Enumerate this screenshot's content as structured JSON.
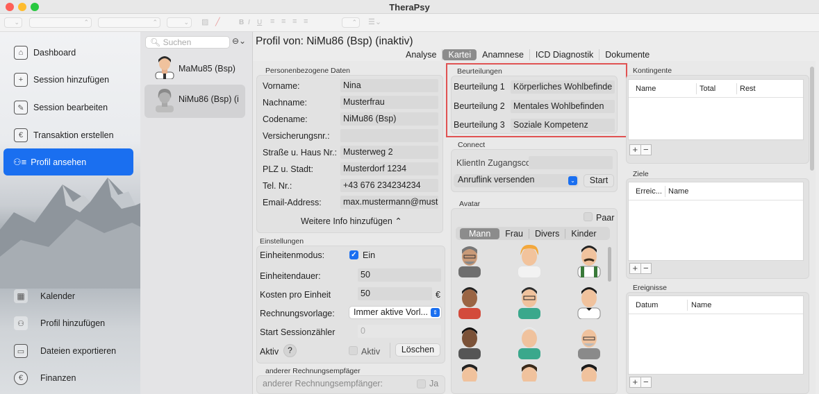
{
  "window": {
    "title": "TheraPsy"
  },
  "sidebar": {
    "items": [
      {
        "label": "Dashboard",
        "icon": "home-icon"
      },
      {
        "label": "Session hinzufügen",
        "icon": "add-session-icon"
      },
      {
        "label": "Session bearbeiten",
        "icon": "edit-session-icon"
      },
      {
        "label": "Transaktion erstellen",
        "icon": "transaction-icon"
      },
      {
        "label": "Profil ansehen",
        "icon": "profile-icon"
      }
    ],
    "bottom_items": [
      {
        "label": "Kalender",
        "icon": "calendar-icon"
      },
      {
        "label": "Profil hinzufügen",
        "icon": "add-profile-icon"
      },
      {
        "label": "Dateien exportieren",
        "icon": "export-icon"
      },
      {
        "label": "Finanzen",
        "icon": "euro-icon"
      }
    ]
  },
  "list": {
    "search_placeholder": "Suchen",
    "people": [
      "MaMu85 (Bsp)",
      "NiMu86 (Bsp) (i"
    ]
  },
  "profile": {
    "title": "Profil von: NiMu86 (Bsp) (inaktiv)",
    "tabs": [
      "Analyse",
      "Kartei",
      "Anamnese",
      "ICD Diagnostik",
      "Dokumente"
    ],
    "selected_tab": "Kartei"
  },
  "personal": {
    "group_label": "Personenbezogene Daten",
    "fields": [
      {
        "label": "Vorname:",
        "value": "Nina"
      },
      {
        "label": "Nachname:",
        "value": "Musterfrau"
      },
      {
        "label": "Codename:",
        "value": "NiMu86 (Bsp)"
      },
      {
        "label": "Versicherungsnr.:",
        "value": ""
      },
      {
        "label": "Straße u. Haus Nr.:",
        "value": "Musterweg 2"
      },
      {
        "label": "PLZ u. Stadt:",
        "value": "Musterdorf 1234"
      },
      {
        "label": "Tel. Nr.:",
        "value": "+43 676 234234234"
      },
      {
        "label": "Email-Address:",
        "value": "max.mustermann@must"
      }
    ],
    "more_info": "Weitere Info hinzufügen ⌃"
  },
  "settings": {
    "group_label": "Einstellungen",
    "unit_mode_label": "Einheitenmodus:",
    "unit_mode_value": "Ein",
    "unit_mode_checked": true,
    "unit_duration_label": "Einheitendauer:",
    "unit_duration_value": "50",
    "cost_label": "Kosten pro Einheit",
    "cost_value": "50",
    "currency": "€",
    "invoice_label": "Rechnungsvorlage:",
    "invoice_value": "Immer aktive Vorl...",
    "session_counter_label": "Start Sessionzähler",
    "session_counter_value": "0",
    "active_label": "Aktiv",
    "help": "?",
    "active_checkbox_label": "Aktiv",
    "active_checked": false,
    "delete_button": "Löschen"
  },
  "recipient": {
    "group_label": "anderer Rechnungsempfäger",
    "field_label": "anderer Rechnungsempfänger:",
    "value": "Ja"
  },
  "ratings": {
    "group_label": "Beurteilungen",
    "items": [
      {
        "label": "Beurteilung 1",
        "value": "Körperliches Wohlbefinde"
      },
      {
        "label": "Beurteilung 2",
        "value": "Mentales Wohlbefinden"
      },
      {
        "label": "Beurteilung 3",
        "value": "Soziale Kompetenz"
      }
    ],
    "highlight_color": "#e05252"
  },
  "connect": {
    "group_label": "Connect",
    "code_label": "KlientIn Zugangscode",
    "code_value": "",
    "call_option": "Anruflink versenden",
    "start_button": "Start"
  },
  "avatar": {
    "group_label": "Avatar",
    "pair_label": "Paar",
    "pair_checked": false,
    "tabs": [
      "Mann",
      "Frau",
      "Divers",
      "Kinder"
    ],
    "selected_tab": "Mann"
  },
  "quotas": {
    "group_label": "Kontingente",
    "columns": [
      "Name",
      "Total",
      "Rest"
    ],
    "add": "+",
    "remove": "−"
  },
  "goals": {
    "group_label": "Ziele",
    "columns": [
      "Erreic...",
      "Name"
    ],
    "add": "+",
    "remove": "−"
  },
  "events": {
    "group_label": "Ereignisse",
    "columns": [
      "Datum",
      "Name"
    ],
    "add": "+",
    "remove": "−"
  },
  "colors": {
    "accent": "#1a6ff0",
    "highlight": "#e05252"
  }
}
